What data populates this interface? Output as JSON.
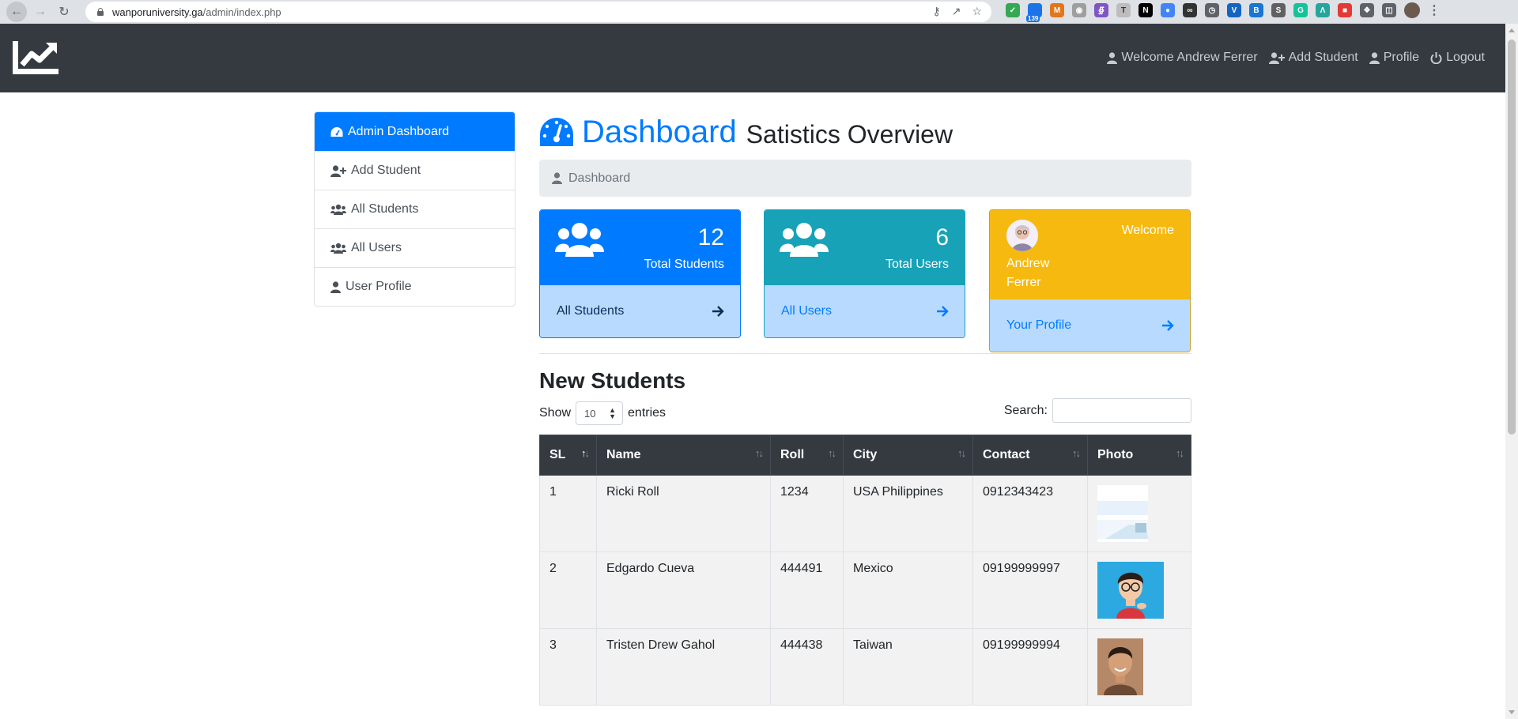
{
  "browser": {
    "url_host": "wanporuniversity.ga",
    "url_path": "/admin/index.php",
    "badge_count": "139"
  },
  "topnav": {
    "welcome": "Welcome Andrew Ferrer",
    "add_student": "Add Student",
    "profile": "Profile",
    "logout": "Logout"
  },
  "sidebar": {
    "items": [
      {
        "label": "Admin Dashboard",
        "icon": "tachometer-icon"
      },
      {
        "label": "Add Student",
        "icon": "user-plus-icon"
      },
      {
        "label": "All Students",
        "icon": "users-icon"
      },
      {
        "label": "All Users",
        "icon": "users-icon"
      },
      {
        "label": "User Profile",
        "icon": "user-icon"
      }
    ]
  },
  "header": {
    "title": "Dashboard",
    "subtitle": "Satistics Overview",
    "breadcrumb": "Dashboard"
  },
  "cards": {
    "students": {
      "count": "12",
      "label": "Total Students",
      "link": "All Students"
    },
    "users": {
      "count": "6",
      "label": "Total Users",
      "link": "All Users"
    },
    "welcome": {
      "label": "Welcome",
      "name": "Andrew Ferrer",
      "link": "Your Profile"
    }
  },
  "students_section": {
    "title": "New Students",
    "show": "Show",
    "entries_value": "10",
    "entries": "entries",
    "search_label": "Search:",
    "columns": [
      "SL",
      "Name",
      "Roll",
      "City",
      "Contact",
      "Photo"
    ],
    "rows": [
      {
        "sl": "1",
        "name": "Ricki Roll",
        "roll": "1234",
        "city": "USA Philippines",
        "contact": "0912343423"
      },
      {
        "sl": "2",
        "name": "Edgardo Cueva",
        "roll": "444491",
        "city": "Mexico",
        "contact": "09199999997"
      },
      {
        "sl": "3",
        "name": "Tristen Drew Gahol",
        "roll": "444438",
        "city": "Taiwan",
        "contact": "09199999994"
      }
    ]
  },
  "colors": {
    "primary": "#007bff",
    "info": "#17a2b8",
    "warning": "#f6b90f",
    "dark": "#343a40",
    "card_footer": "#b8daff"
  }
}
